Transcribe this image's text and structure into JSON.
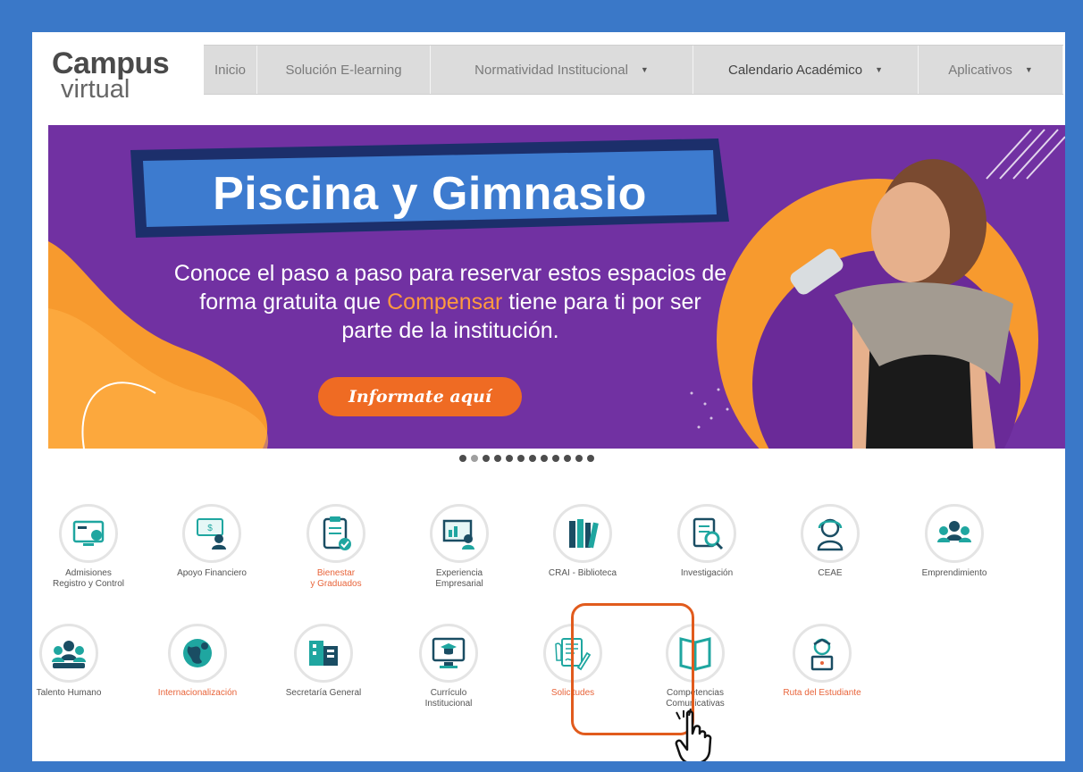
{
  "logo": {
    "line1": "Campus",
    "line2": "virtual"
  },
  "nav": [
    {
      "label": "Inicio",
      "dropdown": false
    },
    {
      "label": "Solución E-learning",
      "dropdown": false
    },
    {
      "label": "Normatividad Institucional",
      "dropdown": true
    },
    {
      "label": "Calendario Académico",
      "dropdown": true
    },
    {
      "label": "Aplicativos",
      "dropdown": true
    }
  ],
  "banner": {
    "title": "Piscina y Gimnasio",
    "line1": "Conoce el paso a paso para reservar estos espacios de",
    "line2_pre": "forma gratuita que ",
    "line2_highlight": "Compensar",
    "line2_post": " tiene para ti por ser",
    "line3": "parte de la institución.",
    "button": "Informate aquí",
    "colors": {
      "purple": "#7131a2",
      "orange": "#ef6b23",
      "title_bg": "#3d7bcf"
    }
  },
  "slider": {
    "count": 12,
    "active_index": 1
  },
  "icons_row1": [
    {
      "label": "Admisiones\nRegistro y Control",
      "icon": "monitor-gear-icon",
      "highlight": false
    },
    {
      "label": "Apoyo Financiero",
      "icon": "person-screen-money-icon",
      "highlight": false
    },
    {
      "label": "Bienestar\ny Graduados",
      "icon": "clipboard-check-icon",
      "highlight": true
    },
    {
      "label": "Experiencia\nEmpresarial",
      "icon": "presentation-board-icon",
      "highlight": false
    },
    {
      "label": "CRAI - Biblioteca",
      "icon": "books-icon",
      "highlight": false
    },
    {
      "label": "Investigación",
      "icon": "document-search-icon",
      "highlight": false
    },
    {
      "label": "CEAE",
      "icon": "person-headset-icon",
      "highlight": false
    },
    {
      "label": "Emprendimiento",
      "icon": "group-people-icon",
      "highlight": false
    }
  ],
  "icons_row2": [
    {
      "label": "Talento Humano",
      "icon": "team-icon",
      "highlight": false
    },
    {
      "label": "Internacionalización",
      "icon": "globe-icon",
      "highlight": true
    },
    {
      "label": "Secretaría General",
      "icon": "building-docs-icon",
      "highlight": false
    },
    {
      "label": "Currículo\nInstitucional",
      "icon": "monitor-graduate-icon",
      "highlight": false
    },
    {
      "label": "Solicitudes",
      "icon": "document-signing-icon",
      "highlight": true,
      "selected": true
    },
    {
      "label": "Competencias\nComunicativas",
      "icon": "open-book-icon",
      "highlight": false
    },
    {
      "label": "Ruta del Estudiante",
      "icon": "student-laptop-icon",
      "highlight": true
    }
  ]
}
